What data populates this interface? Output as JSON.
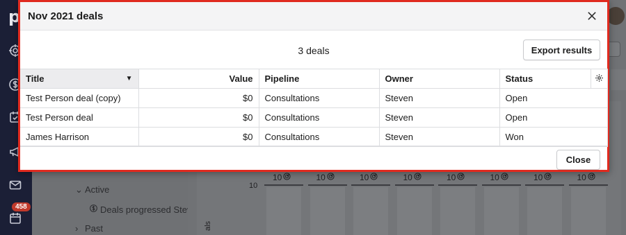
{
  "app": {
    "logo": "p",
    "badge_count": "458",
    "tree": {
      "active_label": "Active",
      "deals_progressed_label": "Deals progressed Stev...",
      "past_label": "Past"
    },
    "goal_chart": {
      "goal_value_label": "10",
      "y_tick_label": "10",
      "y_axis_label": "als",
      "columns": 8
    }
  },
  "modal": {
    "title": "Nov 2021 deals",
    "count_text": "3 deals",
    "export_label": "Export results",
    "close_label": "Close",
    "table": {
      "headers": {
        "title": "Title",
        "value": "Value",
        "pipeline": "Pipeline",
        "owner": "Owner",
        "status": "Status"
      },
      "rows": [
        {
          "title": "Test Person deal (copy)",
          "value": "$0",
          "pipeline": "Consultations",
          "owner": "Steven",
          "status": "Open"
        },
        {
          "title": "Test Person deal",
          "value": "$0",
          "pipeline": "Consultations",
          "owner": "Steven",
          "status": "Open"
        },
        {
          "title": "James Harrison",
          "value": "$0",
          "pipeline": "Consultations",
          "owner": "Steven",
          "status": "Won"
        }
      ]
    }
  },
  "colors": {
    "modal_border": "#e02a1f",
    "sidebar_bg": "#1b1f36",
    "badge_bg": "#c0392b"
  }
}
